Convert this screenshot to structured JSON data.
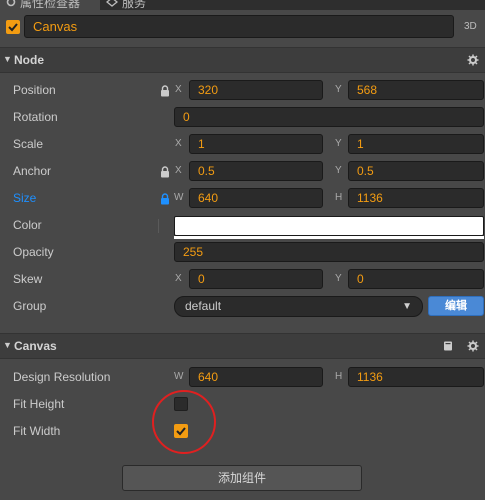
{
  "tabs": [
    {
      "label": "属性检查器",
      "icon": "gear-icon"
    },
    {
      "label": "服务",
      "icon": "diamond-icon"
    }
  ],
  "node": {
    "name": "Canvas",
    "enabled": true,
    "badge": "3D"
  },
  "sections": {
    "node": "Node",
    "canvas": "Canvas"
  },
  "props": {
    "position": {
      "label": "Position",
      "x_axis": "X",
      "x": "320",
      "y_axis": "Y",
      "y": "568"
    },
    "rotation": {
      "label": "Rotation",
      "value": "0"
    },
    "scale": {
      "label": "Scale",
      "x_axis": "X",
      "x": "1",
      "y_axis": "Y",
      "y": "1"
    },
    "anchor": {
      "label": "Anchor",
      "x_axis": "X",
      "x": "0.5",
      "y_axis": "Y",
      "y": "0.5"
    },
    "size": {
      "label": "Size",
      "w_axis": "W",
      "w": "640",
      "h_axis": "H",
      "h": "1136"
    },
    "color": {
      "label": "Color",
      "value": "#ffffff"
    },
    "opacity": {
      "label": "Opacity",
      "value": "255"
    },
    "skew": {
      "label": "Skew",
      "x_axis": "X",
      "x": "0",
      "y_axis": "Y",
      "y": "0"
    },
    "group": {
      "label": "Group",
      "value": "default",
      "edit_label": "编辑"
    }
  },
  "canvas_props": {
    "design_resolution": {
      "label": "Design Resolution",
      "w_axis": "W",
      "w": "640",
      "h_axis": "H",
      "h": "1136"
    },
    "fit_height": {
      "label": "Fit Height",
      "checked": false
    },
    "fit_width": {
      "label": "Fit Width",
      "checked": true
    }
  },
  "add_component_label": "添加组件",
  "colors": {
    "accent": "#f39c12",
    "highlight": "#1e90ff",
    "edit_button": "#4a89d6",
    "annotation": "#e02020"
  }
}
